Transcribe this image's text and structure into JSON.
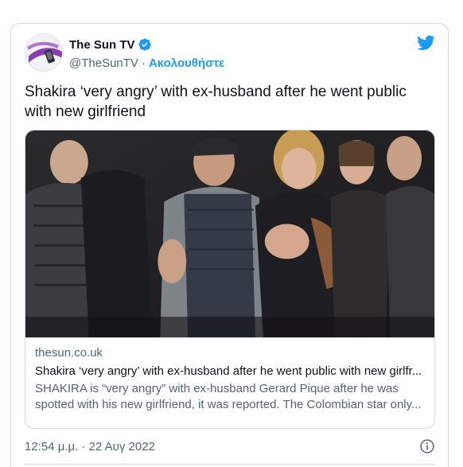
{
  "author": {
    "display_name": "The Sun TV",
    "handle": "@TheSunTV",
    "separator": "·",
    "follow_label": "Ακολουθήστε",
    "verified_icon": "verified-badge-icon",
    "brand_icon": "twitter-bird-icon"
  },
  "tweet": {
    "text": "Shakira ‘very angry’ with ex-husband after he went public with new girlfriend",
    "timestamp": "12:54 μ.μ. · 22 Αυγ 2022"
  },
  "link_card": {
    "domain": "thesun.co.uk",
    "title": "Shakira ‘very angry’ with ex-husband after he went public with new girlfr...",
    "description": "SHAKIRA is “very angry” with ex-husband Gerard Pique after he was spotted with his new girlfriend, it was reported. The Colombian star only..."
  },
  "colors": {
    "accent": "#1d9bf0",
    "text_primary": "#0f1419",
    "text_secondary": "#536471",
    "border": "#cfd9de",
    "avatar_brand": "#7b3fa0"
  }
}
